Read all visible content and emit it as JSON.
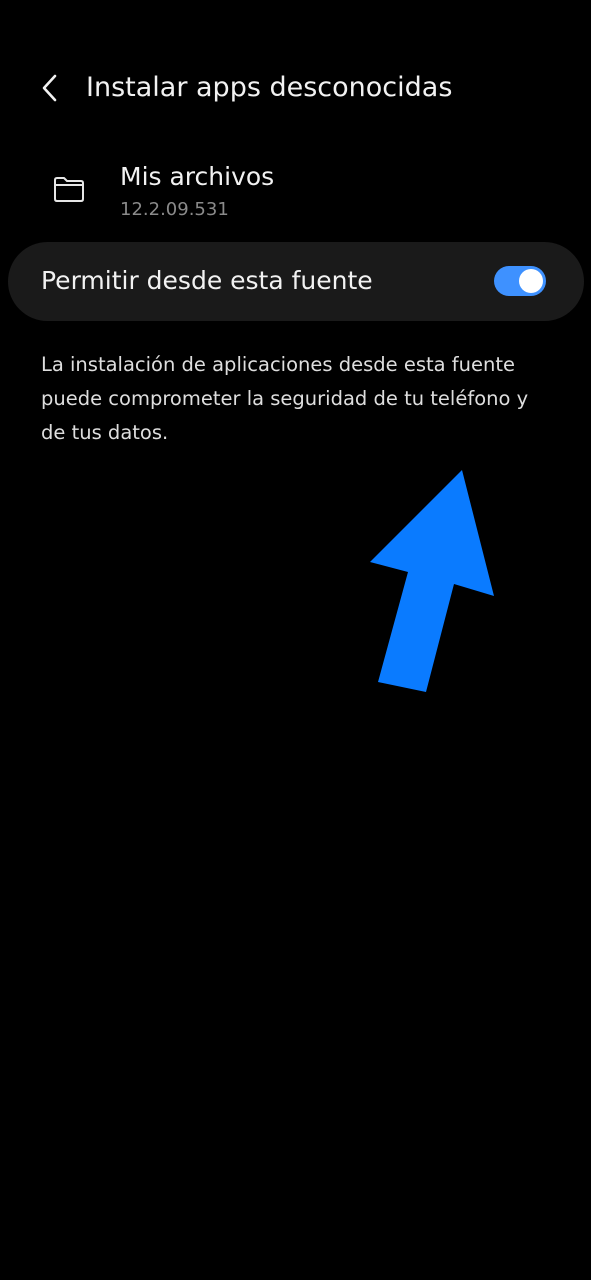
{
  "header": {
    "back_icon": "chevron-left-icon",
    "title": "Instalar apps desconocidas"
  },
  "app": {
    "icon": "folder-icon",
    "name": "Mis archivos",
    "version": "12.2.09.531"
  },
  "permission": {
    "label": "Permitir desde esta fuente",
    "enabled": true,
    "accent_color": "#3e91ff"
  },
  "description": "La instalación de aplicaciones desde esta fuente puede comprometer la seguridad de tu teléfono y de tus datos.",
  "annotation": {
    "icon": "arrow-up-icon",
    "color": "#0a7bff"
  }
}
